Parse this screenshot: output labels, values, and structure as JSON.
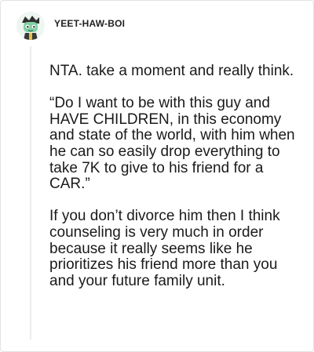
{
  "post": {
    "username": "YEET-HAW-BOI",
    "paragraphs": [
      "NTA. take a moment and really think.",
      "“Do I want to be with this guy and HAVE CHILDREN, in this economy and state of the world, with him when he can so easily drop everything to take 7K to give to his friend for a CAR.”",
      "If you don’t divorce him then I think counseling is very much in order because it really seems like he prioritizes his friend more than you and your future family unit."
    ]
  },
  "icons": {
    "avatar": "cartoon-avatar-icon"
  },
  "colors": {
    "text": "#1a1a1a",
    "username": "#222222",
    "thread_line": "#ececec",
    "card_border": "#e2e2e2"
  }
}
